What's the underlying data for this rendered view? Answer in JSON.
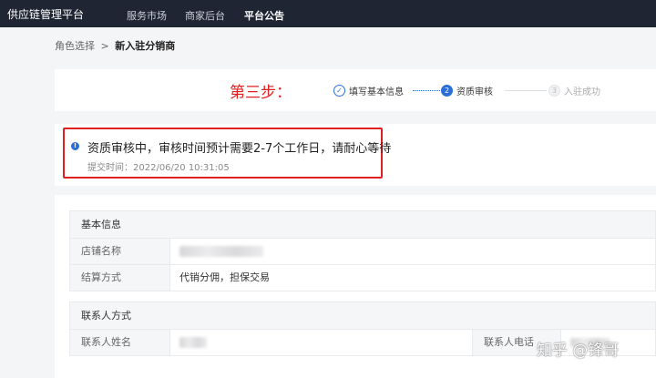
{
  "app": {
    "title": "供应链管理平台"
  },
  "nav": {
    "items": [
      "服务市场",
      "商家后台",
      "平台公告"
    ],
    "active_index": 2
  },
  "breadcrumb": {
    "parent": "角色选择",
    "separator": ">",
    "current": "新入驻分销商"
  },
  "steps": {
    "title": "第三步：",
    "items": [
      {
        "index": "1",
        "label": "填写基本信息",
        "state": "done",
        "icon": "check-icon"
      },
      {
        "index": "2",
        "label": "资质审核",
        "state": "active"
      },
      {
        "index": "3",
        "label": "入驻成功",
        "state": "wait"
      }
    ]
  },
  "status": {
    "message": "资质审核中，审核时间预计需要2-7个工作日，请耐心等待",
    "submit_time": "提交时间：2022/06/20 10:31:05",
    "icon": "info-icon"
  },
  "basic_info": {
    "title": "基本信息",
    "rows": [
      {
        "label": "店铺名称",
        "value": ""
      },
      {
        "label": "结算方式",
        "value": "代销分佣，担保交易"
      }
    ]
  },
  "contact": {
    "title": "联系人方式",
    "name_label": "联系人姓名",
    "phone_label": "联系人电话"
  },
  "watermark": "知乎 @锋哥",
  "colors": {
    "accent": "#2b6fd6",
    "highlight": "#e02020",
    "nav_bg": "#1f2533"
  }
}
